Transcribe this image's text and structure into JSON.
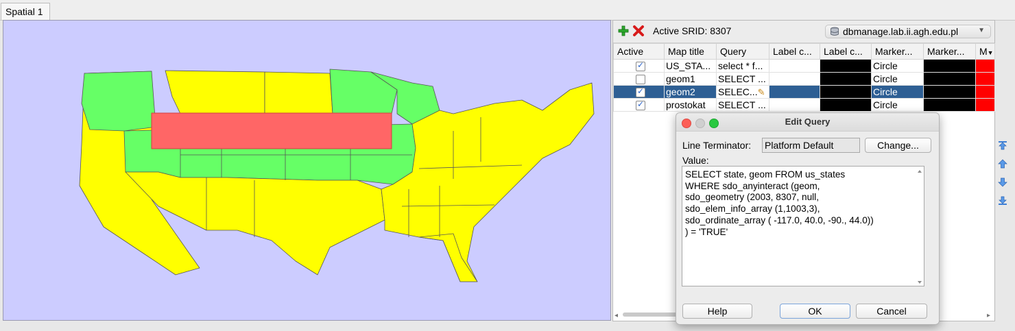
{
  "tab": {
    "label": "Spatial 1"
  },
  "map": {
    "background": "#ccccff",
    "colors": {
      "green": "#66ff66",
      "yellow": "#ffff00",
      "query_rect": "#ff6666"
    }
  },
  "toolbar": {
    "add_icon": "add-icon",
    "remove_icon": "remove-icon",
    "srid_text": "Active SRID: 8307",
    "connection": "dbmanage.lab.ii.agh.edu.pl"
  },
  "grid": {
    "columns": [
      "Active",
      "Map title",
      "Query",
      "Label c...",
      "Label c...",
      "Marker...",
      "Marker...",
      "M"
    ],
    "rows": [
      {
        "active": true,
        "title": "US_STA...",
        "query": "select * f...",
        "label_c1": "",
        "label_color": "#000000",
        "marker": "Circle",
        "marker_color": "#000000",
        "m_color": "#ff0000",
        "selected": false
      },
      {
        "active": false,
        "title": "geom1",
        "query": "SELECT ...",
        "label_c1": "",
        "label_color": "#000000",
        "marker": "Circle",
        "marker_color": "#000000",
        "m_color": "#ff0000",
        "selected": false
      },
      {
        "active": true,
        "title": "geom2",
        "query": "SELEC...",
        "label_c1": "",
        "label_color": "#000000",
        "marker": "Circle",
        "marker_color": "#000000",
        "m_color": "#ff0000",
        "selected": true
      },
      {
        "active": true,
        "title": "prostokat",
        "query": "SELECT ...",
        "label_c1": "",
        "label_color": "#000000",
        "marker": "Circle",
        "marker_color": "#000000",
        "m_color": "#ff0000",
        "selected": false
      }
    ]
  },
  "dialog": {
    "title": "Edit Query",
    "line_terminator_label": "Line Terminator:",
    "line_terminator_value": "Platform Default",
    "change_button": "Change...",
    "value_label": "Value:",
    "value_text": "SELECT state, geom FROM us_states\nWHERE sdo_anyinteract (geom,\nsdo_geometry (2003, 8307, null,\nsdo_elem_info_array (1,1003,3),\nsdo_ordinate_array ( -117.0, 40.0, -90., 44.0))\n) = 'TRUE'",
    "help_button": "Help",
    "ok_button": "OK",
    "cancel_button": "Cancel"
  }
}
